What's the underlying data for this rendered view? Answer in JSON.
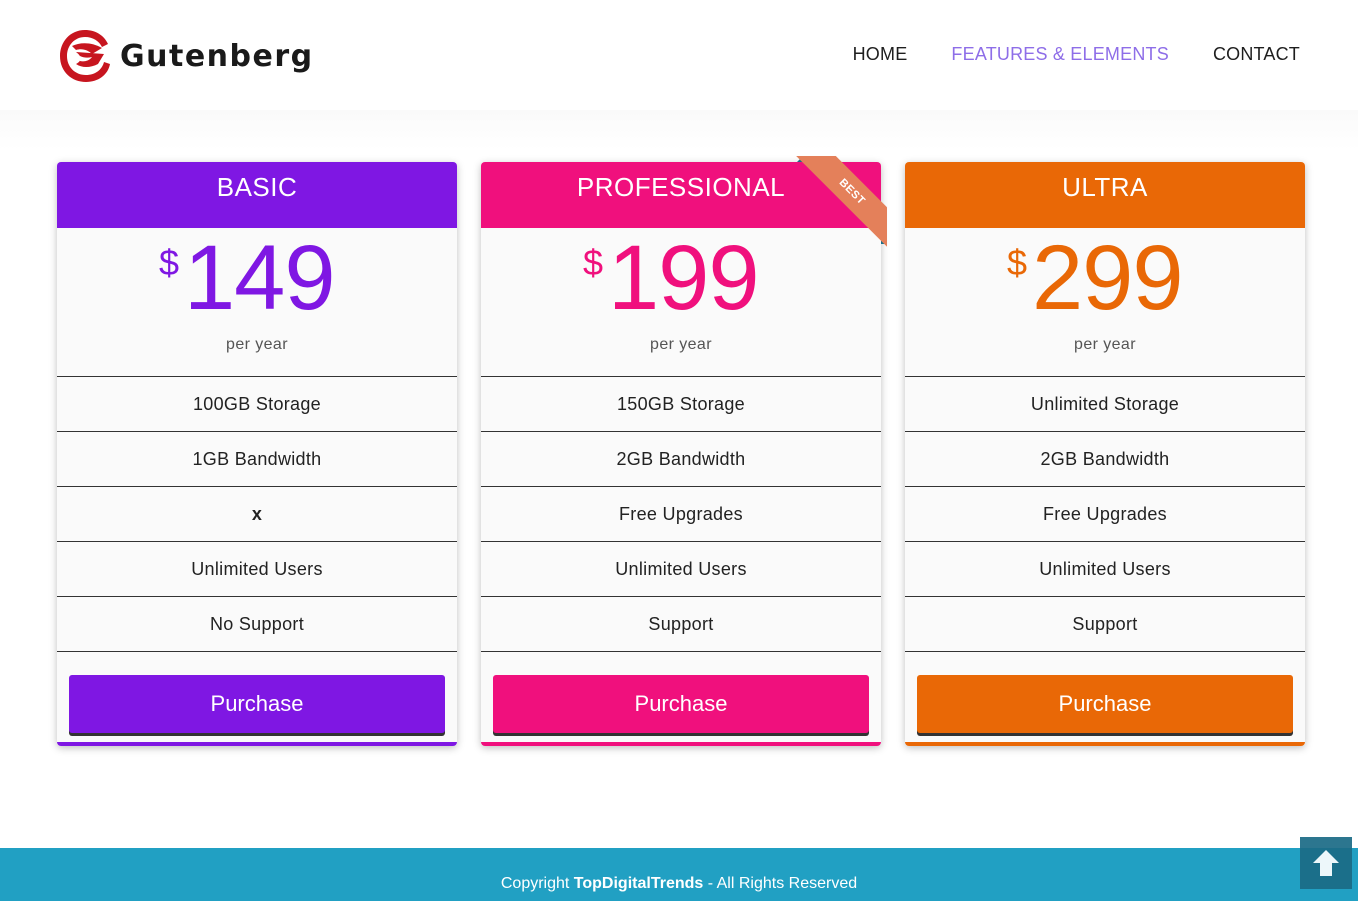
{
  "header": {
    "logo_text": "Gutenberg",
    "nav": [
      {
        "label": "HOME",
        "active": false
      },
      {
        "label": "FEATURES & ELEMENTS",
        "active": true
      },
      {
        "label": "CONTACT",
        "active": false
      }
    ],
    "active_color": "#8e6ee8"
  },
  "plans": [
    {
      "name": "BASIC",
      "currency": "$",
      "price": "149",
      "period": "per year",
      "color": "#7f17e3",
      "features": [
        "100GB Storage",
        "1GB Bandwidth",
        "x",
        "Unlimited Users",
        "No Support"
      ],
      "button": "Purchase"
    },
    {
      "name": "PROFESSIONAL",
      "currency": "$",
      "price": "199",
      "period": "per year",
      "color": "#f0107d",
      "ribbon": "BEST",
      "ribbon_color": "#e4805a",
      "features": [
        "150GB Storage",
        "2GB Bandwidth",
        "Free Upgrades",
        "Unlimited Users",
        "Support"
      ],
      "button": "Purchase"
    },
    {
      "name": "ULTRA",
      "currency": "$",
      "price": "299",
      "period": "per year",
      "color": "#e96806",
      "features": [
        "Unlimited Storage",
        "2GB Bandwidth",
        "Free Upgrades",
        "Unlimited Users",
        "Support"
      ],
      "button": "Purchase"
    }
  ],
  "footer": {
    "prefix": "Copyright ",
    "brand": "TopDigitalTrends",
    "suffix": " - All Rights Reserved",
    "background": "#21a0c3"
  },
  "scroll_top_icon": "arrow-up-icon"
}
